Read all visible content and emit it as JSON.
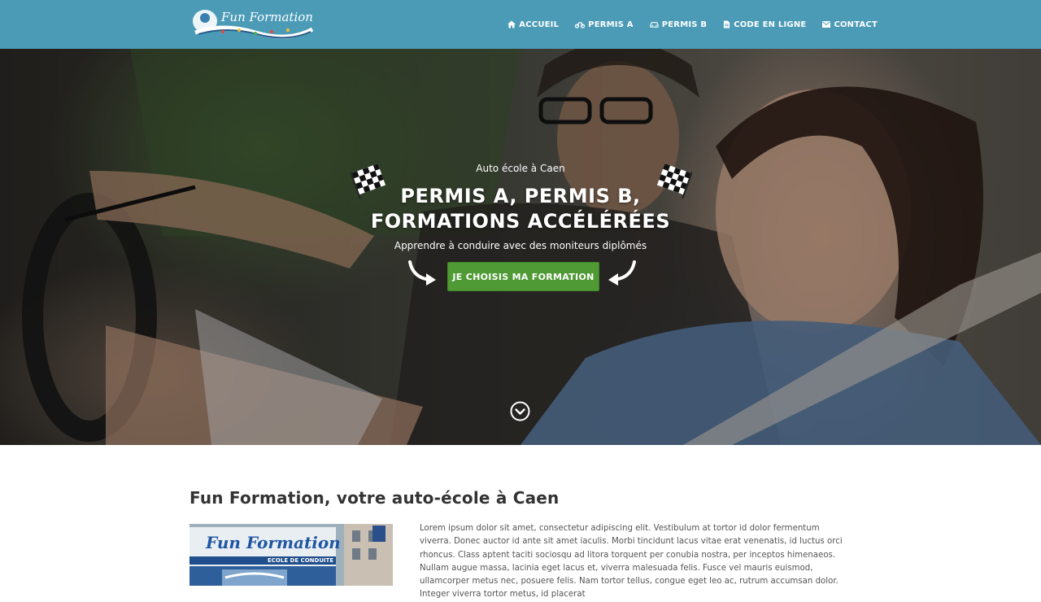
{
  "header": {
    "logo_text": "Fun Formation",
    "bg_color": "#4b9bb7",
    "nav": [
      {
        "label": "ACCUEIL",
        "icon": "home-icon"
      },
      {
        "label": "PERMIS A",
        "icon": "motorcycle-icon"
      },
      {
        "label": "PERMIS B",
        "icon": "car-icon"
      },
      {
        "label": "CODE EN LIGNE",
        "icon": "document-icon"
      },
      {
        "label": "CONTACT",
        "icon": "envelope-icon"
      }
    ]
  },
  "hero": {
    "eyebrow": "Auto école à Caen",
    "title_line1": "PERMIS A, PERMIS B,",
    "title_line2": "FORMATIONS ACCÉLÉRÉES",
    "subtitle": "Apprendre à conduire avec des moniteurs diplômés",
    "cta_label": "JE CHOISIS MA FORMATION",
    "cta_color": "#4f9a35",
    "decorations": [
      "checkered-flag-icon",
      "curved-arrow-icon",
      "chevron-down-circle-icon"
    ]
  },
  "main": {
    "section_title": "Fun Formation, votre auto-école à Caen",
    "photo": {
      "sign_text": "Fun Formation",
      "sign_subtext": "ECOLE DE CONDUITE"
    },
    "paragraph": "Lorem ipsum dolor sit amet, consectetur adipiscing elit. Vestibulum at tortor id dolor fermentum viverra. Donec auctor id ante sit amet iaculis. Morbi tincidunt lacus vitae erat venenatis, id luctus orci rhoncus. Class aptent taciti sociosqu ad litora torquent per conubia nostra, per inceptos himenaeos. Nullam augue massa, lacinia eget lacus et, viverra malesuada felis. Fusce vel mauris euismod, ullamcorper metus nec, posuere felis. Nam tortor tellus, congue eget leo ac, rutrum accumsan dolor. Integer viverra tortor metus, id placerat"
  }
}
